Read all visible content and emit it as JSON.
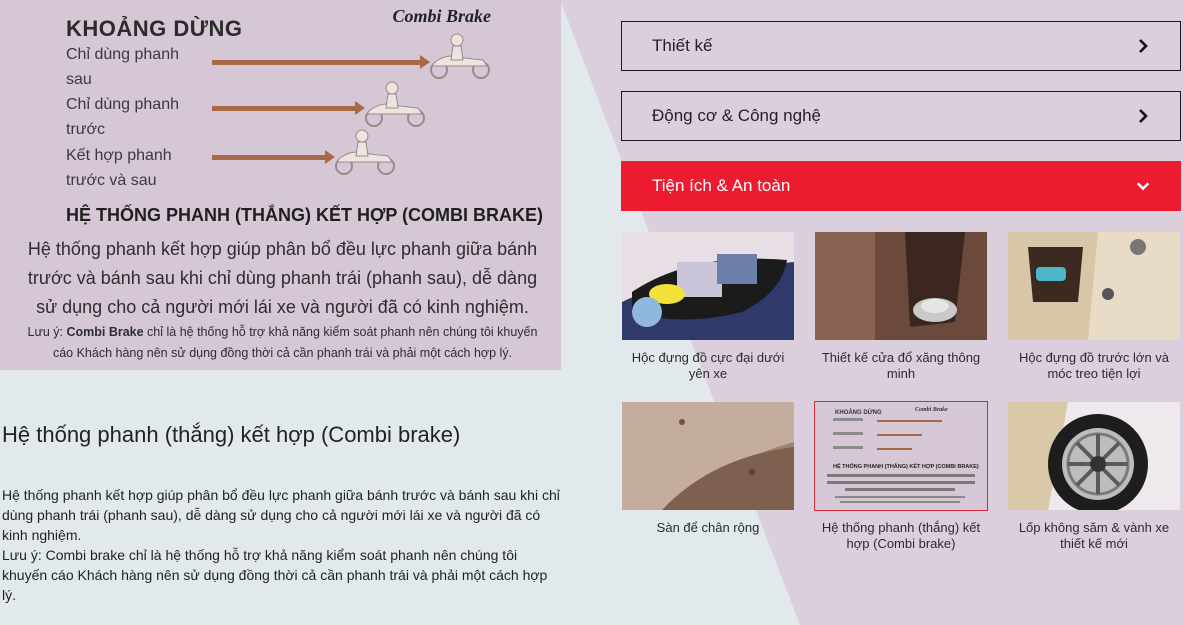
{
  "hero": {
    "brand": "Combi Brake",
    "stop_title": "KHOẢNG DỪNG",
    "rows": [
      {
        "label": "Chỉ dùng phanh sau"
      },
      {
        "label": "Chỉ dùng phanh trước"
      },
      {
        "label": "Kết hợp phanh trước và sau"
      }
    ],
    "system_title": "HỆ THỐNG PHANH (THẮNG) KẾT HỢP (COMBI BRAKE)",
    "description": "Hệ thống phanh kết hợp giúp phân bổ đều lực phanh giữa bánh trước và bánh sau khi chỉ dùng phanh trái (phanh sau), dễ dàng sử dụng cho cả người mới lái xe và người đã có kinh nghiệm.",
    "note_prefix": "Lưu ý: ",
    "note_bold": "Combi Brake",
    "note_rest": " chỉ là hệ thống hỗ trợ khả năng kiểm soát phanh nên chúng tôi khuyến cáo Khách hàng nên sử dụng đồng thời cả cần phanh trái và phải một cách hợp lý."
  },
  "detail": {
    "title": "Hệ thống phanh (thắng) kết hợp (Combi brake)",
    "description": "Hệ thống phanh kết hợp giúp phân bổ đều lực phanh giữa bánh trước và bánh sau khi chỉ dùng phanh trái (phanh sau), dễ dàng sử dụng cho cả người mới lái xe và người đã có kinh nghiệm.",
    "note": "Lưu ý: Combi brake chỉ là hệ thống hỗ trợ khả năng kiểm soát phanh nên chúng tôi khuyến cáo Khách hàng nên sử dụng đồng thời cả cần phanh trái và phải một cách hợp lý."
  },
  "accordion": [
    {
      "label": "Thiết kế",
      "icon": "chevron-right-icon",
      "active": false
    },
    {
      "label": "Động cơ & Công nghệ",
      "icon": "chevron-right-icon",
      "active": false
    },
    {
      "label": "Tiện ích & An toàn",
      "icon": "chevron-down-icon",
      "active": true
    }
  ],
  "features": [
    {
      "caption": "Hộc đựng đồ cực đại dưới yên xe",
      "selected": false
    },
    {
      "caption": "Thiết kế cửa đổ xăng thông minh",
      "selected": false
    },
    {
      "caption": "Hộc đựng đồ trước lớn và móc treo tiện lợi",
      "selected": false
    },
    {
      "caption": "Sàn để chân rộng",
      "selected": false
    },
    {
      "caption": "Hệ thống phanh (thắng) kết hợp (Combi brake)",
      "selected": true
    },
    {
      "caption": "Lốp không săm & vành xe thiết kế mới",
      "selected": false
    }
  ],
  "colors": {
    "accent": "#ed1b2f",
    "left_bg": "#e2e9ec",
    "right_bg": "#dccfdd"
  }
}
